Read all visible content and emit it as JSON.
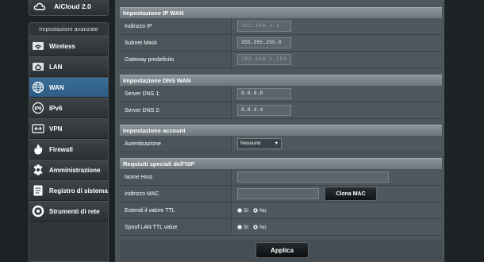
{
  "sidebar": {
    "aicloud_label": "AiCloud 2.0",
    "advanced_title": "Impostazioni avanzate",
    "items": [
      {
        "label": "Wireless",
        "icon": "wifi-icon",
        "active": false
      },
      {
        "label": "LAN",
        "icon": "home-icon",
        "active": false
      },
      {
        "label": "WAN",
        "icon": "globe-icon",
        "active": true
      },
      {
        "label": "IPv6",
        "icon": "ipv6-icon",
        "active": false
      },
      {
        "label": "VPN",
        "icon": "vpn-icon",
        "active": false
      },
      {
        "label": "Firewall",
        "icon": "fire-icon",
        "active": false
      },
      {
        "label": "Amministrazione",
        "icon": "gear-icon",
        "active": false
      },
      {
        "label": "Registro di sistema",
        "icon": "log-icon",
        "active": false
      },
      {
        "label": "Strumenti di rete",
        "icon": "tools-icon",
        "active": false
      }
    ]
  },
  "ip_wan": {
    "header": "Impostazione IP WAN",
    "ip_label": "Indirizzo IP",
    "ip_value": "192.168.1.1",
    "mask_label": "Subnet Mask",
    "mask_value": "255.255.255.0",
    "gateway_label": "Gateway predefinito",
    "gateway_value": "192.168.1.254"
  },
  "dns_wan": {
    "header": "Impostazione DNS WAN",
    "dns1_label": "Server DNS 1:",
    "dns1_value": "8.8.8.8",
    "dns2_label": "Server DNS 2:",
    "dns2_value": "8.8.4.4"
  },
  "account": {
    "header": "Impostazione account",
    "auth_label": "Autenticazione",
    "auth_value": "Nessuno"
  },
  "isp": {
    "header": "Requisiti speciali dell'ISP",
    "host_label": "Nome Host",
    "host_value": "",
    "mac_label": "Indirizzo MAC",
    "mac_value": "",
    "clone_button": "Clona MAC",
    "ttl_label": "Estendi il valore TTL",
    "spoof_label": "Spoof LAN TTL value",
    "yes_label": "Sì",
    "no_label": "No"
  },
  "apply_button": "Applica",
  "colors": {
    "active_item": "#2d5c84",
    "panel": "#4d565c",
    "background": "#1d2225"
  }
}
